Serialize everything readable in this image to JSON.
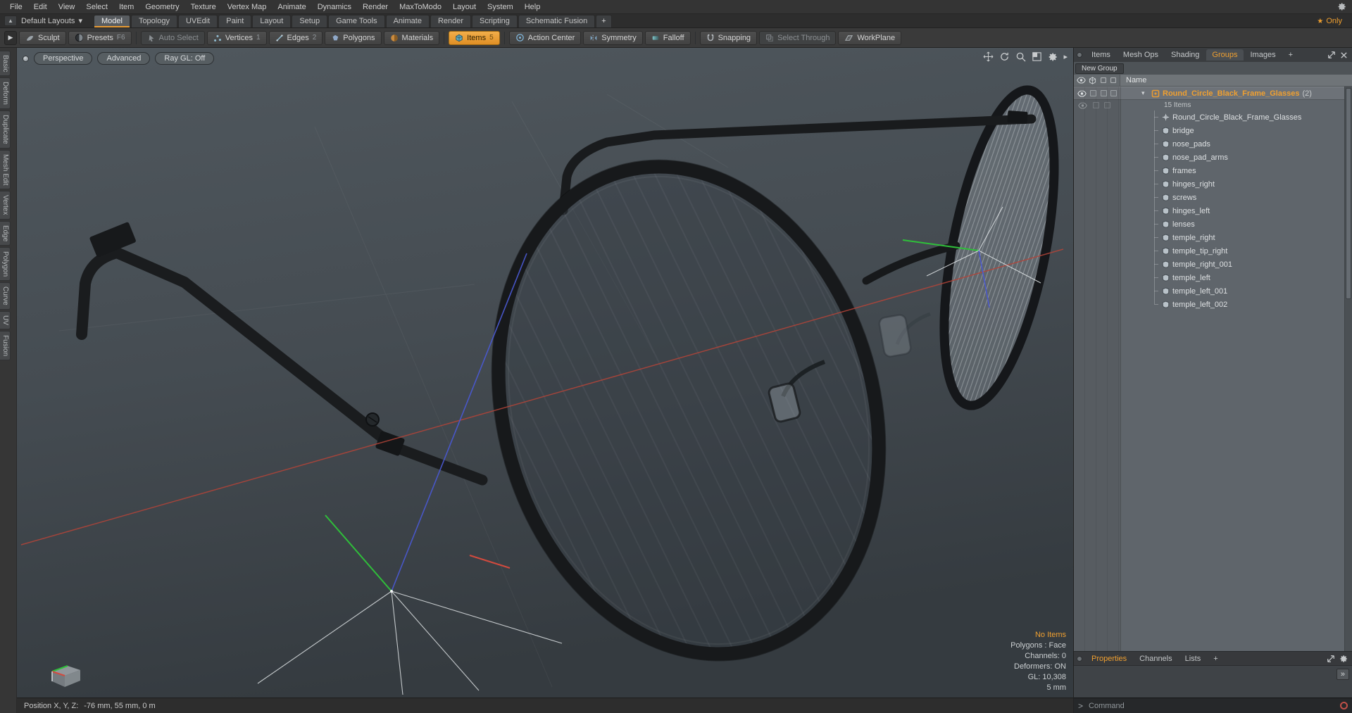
{
  "menubar": {
    "items": [
      "File",
      "Edit",
      "View",
      "Select",
      "Item",
      "Geometry",
      "Texture",
      "Vertex Map",
      "Animate",
      "Dynamics",
      "Render",
      "MaxToModo",
      "Layout",
      "System",
      "Help"
    ]
  },
  "layoutbar": {
    "layout_switcher": "Default Layouts",
    "caret": "▾",
    "tabs": [
      "Model",
      "Topology",
      "UVEdit",
      "Paint",
      "Layout",
      "Setup",
      "Game Tools",
      "Animate",
      "Render",
      "Scripting",
      "Schematic Fusion"
    ],
    "add_tab": "+",
    "active_tab": "Model",
    "star": "★",
    "only_label": "Only"
  },
  "toolbar": {
    "overflow_arrow": "▶",
    "buttons": [
      {
        "label": "Sculpt"
      },
      {
        "label": "Presets",
        "badge": "F6"
      },
      {
        "label": "Auto Select"
      },
      {
        "label": "Vertices",
        "badge": "1"
      },
      {
        "label": "Edges",
        "badge": "2"
      },
      {
        "label": "Polygons"
      },
      {
        "label": "Materials"
      },
      {
        "label": "Items",
        "badge": "5"
      },
      {
        "label": "Action Center"
      },
      {
        "label": "Symmetry"
      },
      {
        "label": "Falloff"
      },
      {
        "label": "Snapping"
      },
      {
        "label": "Select Through"
      },
      {
        "label": "WorkPlane"
      }
    ]
  },
  "toolbox": {
    "tabs": [
      "Basic",
      "Deform",
      "Duplicate",
      "Mesh Edit",
      "Vertex",
      "Edge",
      "Polygon",
      "Curve",
      "UV",
      "Fusion"
    ]
  },
  "viewport": {
    "buttons": [
      "Perspective",
      "Advanced",
      "Ray GL: Off"
    ],
    "menu_arrow": "▸",
    "info": {
      "no_items": "No Items",
      "lines": [
        "Polygons : Face",
        "Channels: 0",
        "Deformers: ON",
        "GL: 10,308",
        "5 mm"
      ]
    }
  },
  "statusbar": {
    "label": "Position X, Y, Z:",
    "value": "-76 mm, 55 mm, 0 m"
  },
  "right_panel": {
    "tabs": [
      "Items",
      "Mesh Ops",
      "Shading",
      "Groups",
      "Images"
    ],
    "active_tab": "Groups",
    "add_tab": "+",
    "new_group_button": "New Group",
    "name_header": "Name",
    "disclosure": "▾",
    "group": {
      "name": "Round_Circle_Black_Frame_Glasses",
      "count": "(2)",
      "items_label": "15 Items"
    },
    "children": [
      "Round_Circle_Black_Frame_Glasses",
      "bridge",
      "nose_pads",
      "nose_pad_arms",
      "frames",
      "hinges_right",
      "screws",
      "hinges_left",
      "lenses",
      "temple_right",
      "temple_tip_right",
      "temple_right_001",
      "temple_left",
      "temple_left_001",
      "temple_left_002"
    ],
    "bottom_tabs": [
      "Properties",
      "Channels",
      "Lists"
    ],
    "bottom_active_tab": "Properties",
    "bottom_add_tab": "+",
    "expand_button": "»",
    "command_prompt": ">",
    "command_placeholder": "Command"
  },
  "colors": {
    "accent": "#f0a030",
    "items_button": "#e8952f",
    "axis_red": "#c9463c",
    "axis_green": "#2fbf3a",
    "axis_blue": "#4a58d0"
  }
}
